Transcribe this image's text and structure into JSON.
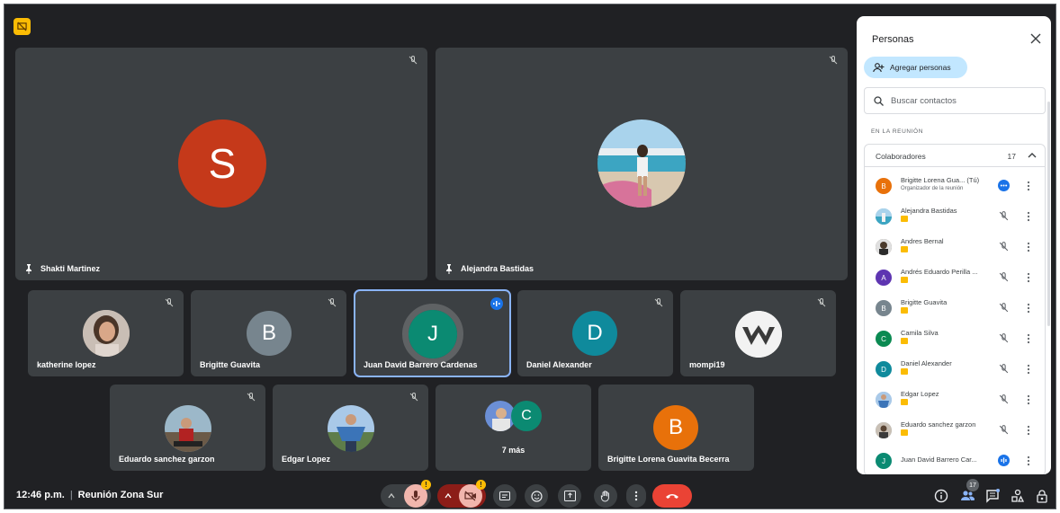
{
  "meeting": {
    "time": "12:46 p.m.",
    "title": "Reunión Zona Sur",
    "participant_count": "17",
    "warning_badge": "!"
  },
  "main_tiles": [
    {
      "name": "Shakti Martinez",
      "initial": "S",
      "color": "#c5391a"
    },
    {
      "name": "Alejandra Bastidas"
    }
  ],
  "tiles_row2": [
    {
      "name": "katherine lopez"
    },
    {
      "name": "Brigitte Guavita",
      "initial": "B",
      "color": "#77858e"
    },
    {
      "name": "Juan David Barrero Cardenas",
      "initial": "J",
      "color": "#0b8a72"
    },
    {
      "name": "Daniel Alexander",
      "initial": "D",
      "color": "#0f8a9c"
    },
    {
      "name": "mompi19"
    }
  ],
  "tiles_row3": [
    {
      "name": "Eduardo sanchez garzon"
    },
    {
      "name": "Edgar Lopez"
    },
    {
      "name": "",
      "more_label": "7 más",
      "initial": "C",
      "color": "#0b8a72"
    },
    {
      "name": "Brigitte Lorena Guavita Becerra",
      "initial": "B",
      "color": "#e8710a"
    }
  ],
  "panel": {
    "title": "Personas",
    "add_label": "Agregar personas",
    "search_placeholder": "Buscar contactos",
    "section_label": "EN LA REUNIÓN",
    "group_label": "Colaboradores",
    "group_count": "17",
    "people": [
      {
        "name": "Brigitte Lorena Gua... (Tú)",
        "sub": "Organizador de la reunión",
        "initial": "B",
        "color": "#e8710a"
      },
      {
        "name": "Alejandra Bastidas"
      },
      {
        "name": "Andres Bernal"
      },
      {
        "name": "Andrés Eduardo Perilla ...",
        "initial": "A",
        "color": "#5e35b1"
      },
      {
        "name": "Brigitte Guavita",
        "initial": "B",
        "color": "#77858e"
      },
      {
        "name": "Camila Silva",
        "initial": "C",
        "color": "#0b8a52"
      },
      {
        "name": "Daniel Alexander",
        "initial": "D",
        "color": "#0f8a9c"
      },
      {
        "name": "Edgar Lopez"
      },
      {
        "name": "Eduardo sanchez garzon"
      },
      {
        "name": "Juan David Barrero Car...",
        "initial": "J",
        "color": "#0b8a72"
      }
    ]
  },
  "icons": {
    "logo": "presenting-icon",
    "pin": "pin-icon",
    "mute": "mic-off-icon",
    "speaking": "audio-level-icon",
    "mic": "mic-icon",
    "camera": "camera-off-icon",
    "captions": "captions-icon",
    "emoji": "emoji-icon",
    "present": "present-icon",
    "hand": "raise-hand-icon",
    "more": "more-vert-icon",
    "end": "end-call-icon",
    "info": "info-icon",
    "people": "people-icon",
    "chat": "chat-icon",
    "activities": "activities-icon",
    "lock": "host-controls-icon"
  }
}
